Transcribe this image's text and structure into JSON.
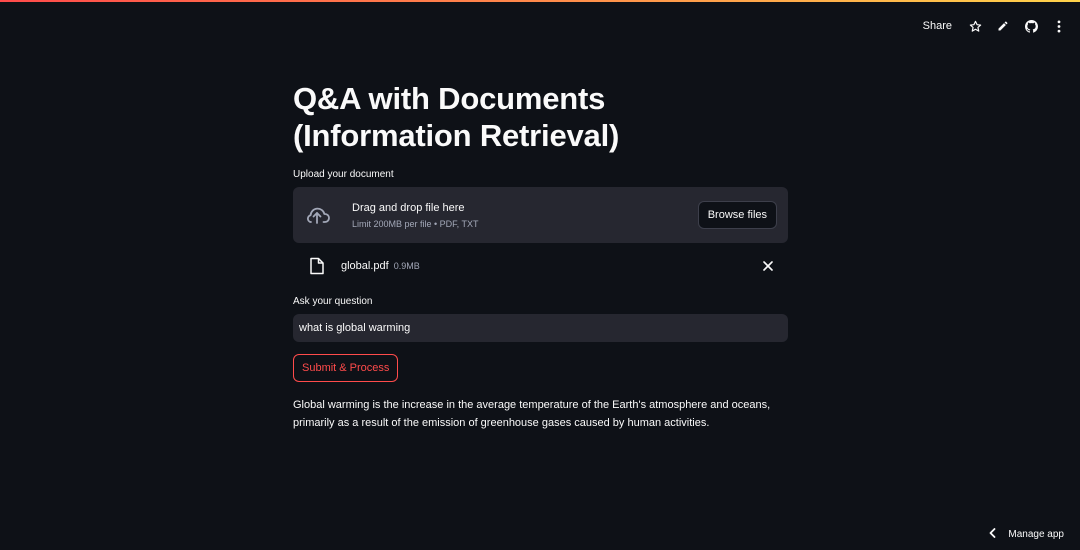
{
  "toolbar": {
    "share_label": "Share",
    "icons": [
      "star-icon",
      "pencil-icon",
      "github-icon",
      "more-vertical-icon"
    ]
  },
  "page": {
    "title": "Q&A with Documents (Information Retrieval)"
  },
  "upload": {
    "label": "Upload your document",
    "drop_text": "Drag and drop file here",
    "limit_text": "Limit 200MB per file • PDF, TXT",
    "browse_label": "Browse files",
    "file": {
      "name": "global.pdf",
      "size": "0.9MB"
    }
  },
  "question": {
    "label": "Ask your question",
    "value": "what is global warming"
  },
  "submit_label": "Submit & Process",
  "answer": "Global warming is the increase in the average temperature of the Earth's atmosphere and oceans, primarily as a result of the emission of greenhouse gases caused by human activities.",
  "footer": {
    "manage_label": "Manage app"
  },
  "colors": {
    "background": "#0e1117",
    "surface": "#262730",
    "accent": "#ff4b4b"
  }
}
